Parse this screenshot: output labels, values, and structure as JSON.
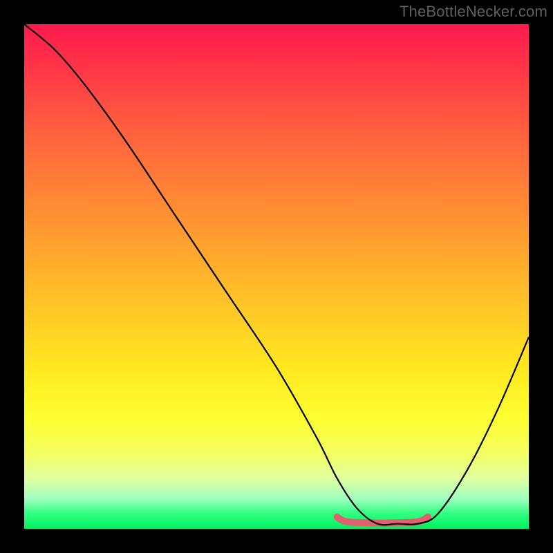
{
  "watermark": "TheBottleNecker.com",
  "chart_data": {
    "type": "line",
    "title": "",
    "xlabel": "",
    "ylabel": "",
    "xlim": [
      0,
      100
    ],
    "ylim": [
      0,
      100
    ],
    "background_gradient_top": "#ff1a4d",
    "background_gradient_bottom": "#00f060",
    "series": [
      {
        "name": "bottleneck-curve",
        "color": "#000000",
        "x": [
          0,
          6,
          12,
          20,
          30,
          40,
          50,
          58,
          62,
          66,
          70,
          74,
          78,
          82,
          88,
          94,
          100
        ],
        "y": [
          100,
          95,
          88,
          77,
          62,
          47,
          32,
          18,
          10,
          4,
          1,
          1,
          1,
          3,
          12,
          24,
          38
        ]
      }
    ],
    "optimal_range": {
      "name": "optimal-band",
      "color": "#e06070",
      "x_start": 62,
      "x_end": 80,
      "y": 1
    }
  }
}
